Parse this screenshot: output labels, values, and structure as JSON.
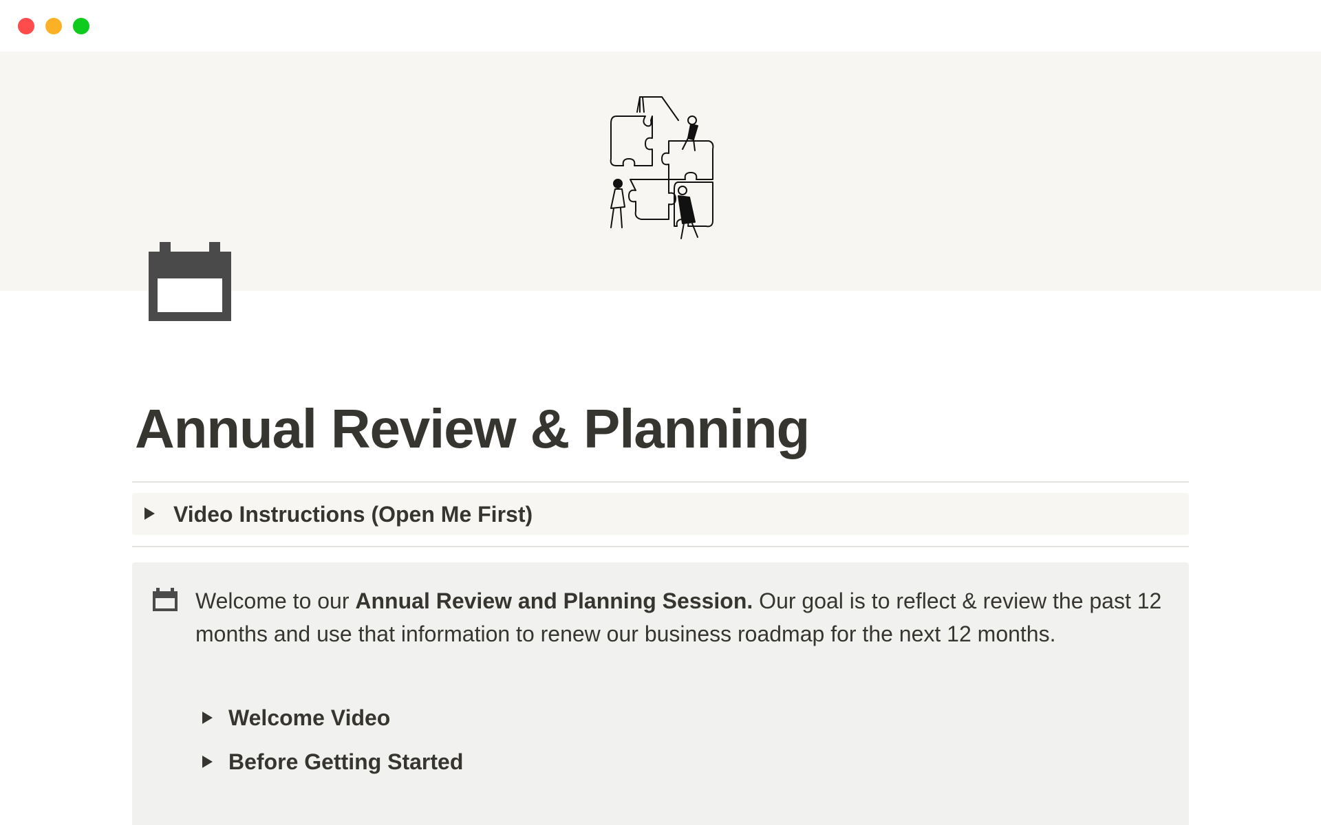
{
  "window": {
    "controls": [
      "close",
      "minimize",
      "maximize"
    ],
    "colors": {
      "close": "#fe4b4c",
      "minimize": "#fbb125",
      "maximize": "#0ecb1e"
    }
  },
  "cover": {
    "illustration": "puzzle-illustration",
    "background": "#f7f6f3"
  },
  "page": {
    "icon": "calendar-icon",
    "title": "Annual Review & Planning"
  },
  "toggle": {
    "label": "Video Instructions (Open Me First)",
    "icon": "triangle-right-icon"
  },
  "callout": {
    "icon": "calendar-icon",
    "intro": "Welcome to our ",
    "bold": "Annual Review and Planning Session.",
    "rest": " Our goal is to reflect & review the past 12 months and use that information to renew our business roadmap for the next 12 months.",
    "sub_toggles": [
      {
        "label": "Welcome Video"
      },
      {
        "label": "Before Getting Started"
      }
    ]
  },
  "colors": {
    "text": "#37352f",
    "callout_bg": "#f1f1ef",
    "toggle_bg": "#f7f6f3"
  }
}
